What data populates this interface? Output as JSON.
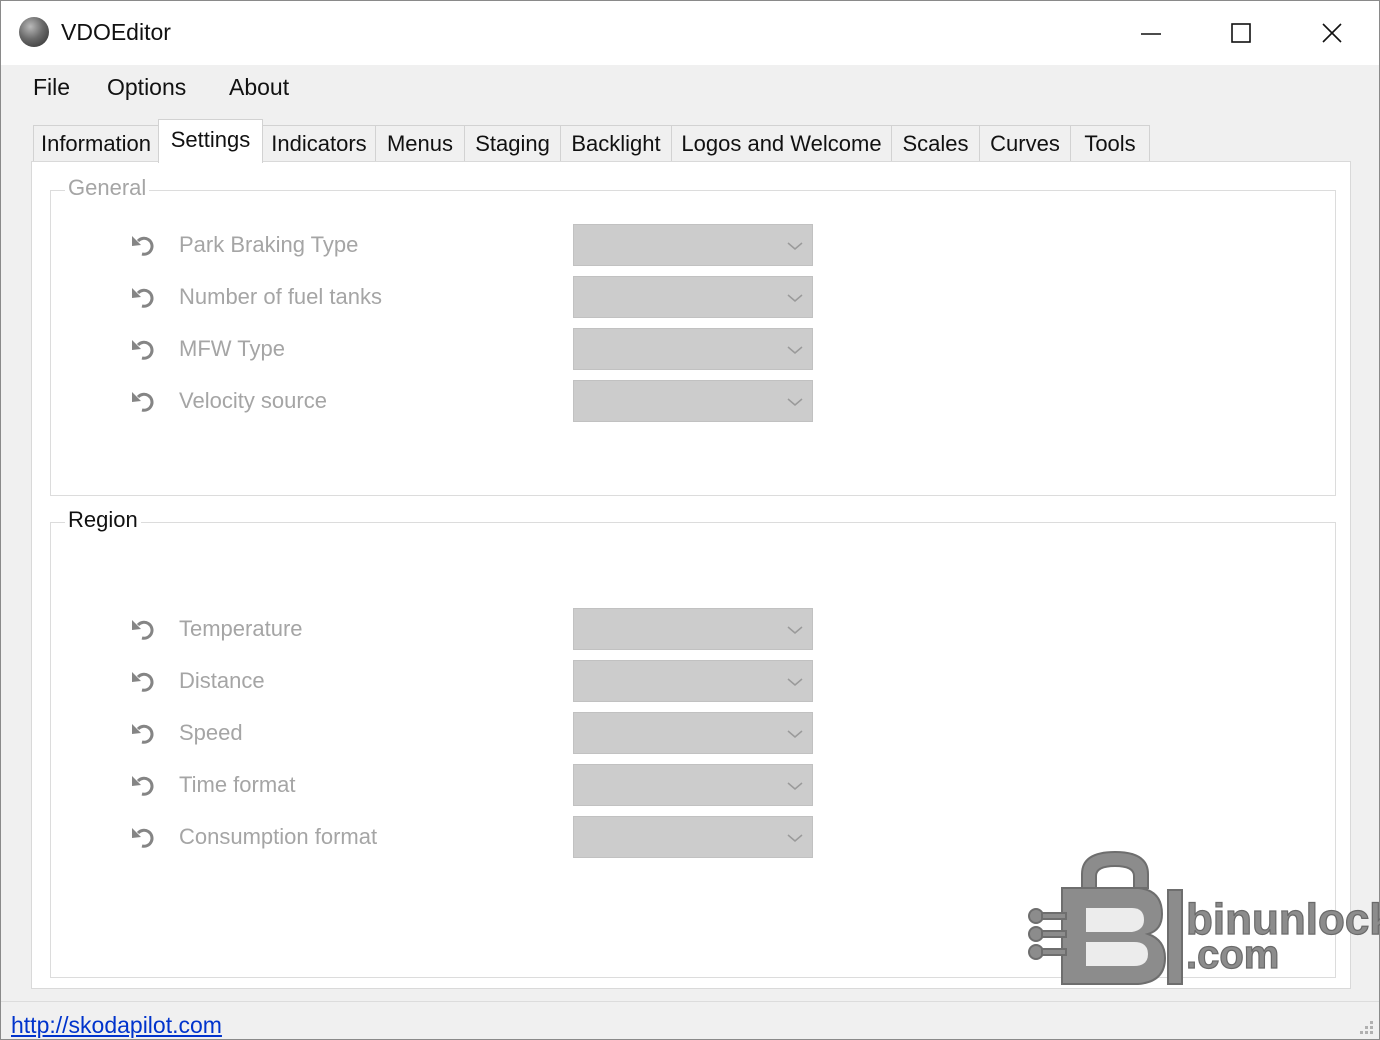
{
  "window": {
    "title": "VDOEditor"
  },
  "menu": [
    "File",
    "Options",
    "About"
  ],
  "tabs": [
    "Information",
    "Settings",
    "Indicators",
    "Menus",
    "Staging",
    "Backlight",
    "Logos and Welcome",
    "Scales",
    "Curves",
    "Tools"
  ],
  "active_tab": "Settings",
  "general": {
    "title": "General",
    "rows": [
      {
        "label": "Park Braking Type",
        "value": ""
      },
      {
        "label": "Number of fuel tanks",
        "value": ""
      },
      {
        "label": "MFW Type",
        "value": ""
      },
      {
        "label": "Velocity source",
        "value": ""
      }
    ]
  },
  "region": {
    "title": "Region",
    "rows": [
      {
        "label": "Temperature",
        "value": ""
      },
      {
        "label": "Distance",
        "value": ""
      },
      {
        "label": "Speed",
        "value": ""
      },
      {
        "label": "Time format",
        "value": ""
      },
      {
        "label": "Consumption format",
        "value": ""
      }
    ]
  },
  "status": {
    "link": "http://skodapilot.com"
  },
  "watermark": {
    "line1": "binunlock",
    "line2": ".com"
  },
  "colors": {
    "disabled_text": "#a5a5a5",
    "combo_bg": "#cccccc",
    "link": "#0033cc"
  }
}
